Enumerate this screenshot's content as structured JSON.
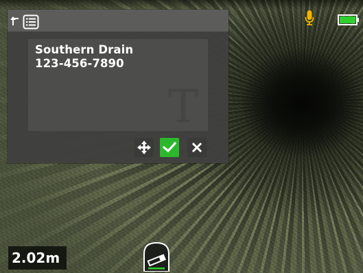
{
  "text_dialog": {
    "lines": [
      "Southern Drain",
      "123-456-7890"
    ],
    "watermark_glyph": "T",
    "buttons": {
      "move": "move",
      "confirm": "confirm",
      "cancel": "cancel"
    }
  },
  "header_icons": {
    "back": "return-arrow-icon",
    "list": "list-icon"
  },
  "status": {
    "microphone": "microphone-icon",
    "battery": "battery-icon",
    "battery_level": 1.0,
    "battery_color": "#2fcf2f",
    "mic_color": "#f0b400"
  },
  "distance": {
    "value": "2.02m"
  },
  "colors": {
    "accent_green": "#2bb82b",
    "dialog_bg": "#40403e",
    "header_bg": "#5c5d5a"
  }
}
